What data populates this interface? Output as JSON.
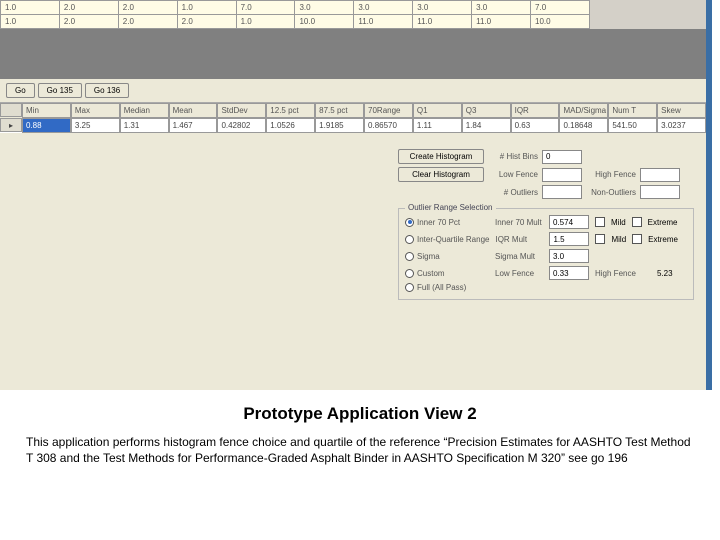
{
  "top_grid": {
    "rows": [
      [
        "1.0",
        "2.0",
        "2.0",
        "1.0",
        "7.0",
        "3.0",
        "3.0",
        "3.0",
        "3.0",
        "7.0"
      ],
      [
        "1.0",
        "2.0",
        "2.0",
        "2.0",
        "1.0",
        "10.0",
        "11.0",
        "11.0",
        "11.0",
        "10.0"
      ]
    ]
  },
  "buttons": {
    "go": "Go",
    "go135": "Go 135",
    "go136": "Go 136"
  },
  "stats": {
    "headers": [
      "Min",
      "Max",
      "Median",
      "Mean",
      "StdDev",
      "12.5 pct",
      "87.5 pct",
      "70Range",
      "Q1",
      "Q3",
      "IQR",
      "MAD/Sigma",
      "Num T",
      "Skew"
    ],
    "values": [
      "0.88",
      "3.25",
      "1.31",
      "1.467",
      "0.42802",
      "1.0526",
      "1.9185",
      "0.86570",
      "1.11",
      "1.84",
      "0.63",
      "0.18648",
      "541.50",
      "3.0237"
    ]
  },
  "histogram": {
    "create_btn": "Create Histogram",
    "clear_btn": "Clear Histogram",
    "hist_bins_label": "# Hist Bins",
    "hist_bins": "0",
    "low_fence_label": "Low Fence",
    "low_fence": "",
    "high_fence_label": "High Fence",
    "high_fence": "",
    "outliers_label": "# Outliers",
    "outliers": "",
    "non_outliers_label": "Non-Outliers",
    "non_outliers": ""
  },
  "outlier": {
    "legend": "Outlier Range Selection",
    "radios": {
      "inner70pct": "Inner 70 Pct",
      "iqr": "Inter-Quartile Range",
      "sigma": "Sigma",
      "custom": "Custom",
      "fullpass": "Full (All Pass)"
    },
    "labels": {
      "inner70mult": "Inner 70 Mult",
      "iqr_mult": "IQR Mult",
      "sigma_mult": "Sigma Mult",
      "low_fence": "Low Fence",
      "high_fence": "High Fence"
    },
    "values": {
      "inner70mult": "0.574",
      "iqr_mult": "1.5",
      "sigma_mult": "3.0",
      "low_fence": "0.33",
      "high_fence": "5.23"
    },
    "checks": {
      "mild": "Mild",
      "extreme": "Extreme"
    }
  },
  "caption": {
    "title": "Prototype Application View 2",
    "body": "This application performs histogram fence choice and quartile of the reference “Precision Estimates for AASHTO Test Method T 308 and the Test Methods for Performance-Graded Asphalt Binder in AASHTO Specification M 320” see go 196"
  }
}
